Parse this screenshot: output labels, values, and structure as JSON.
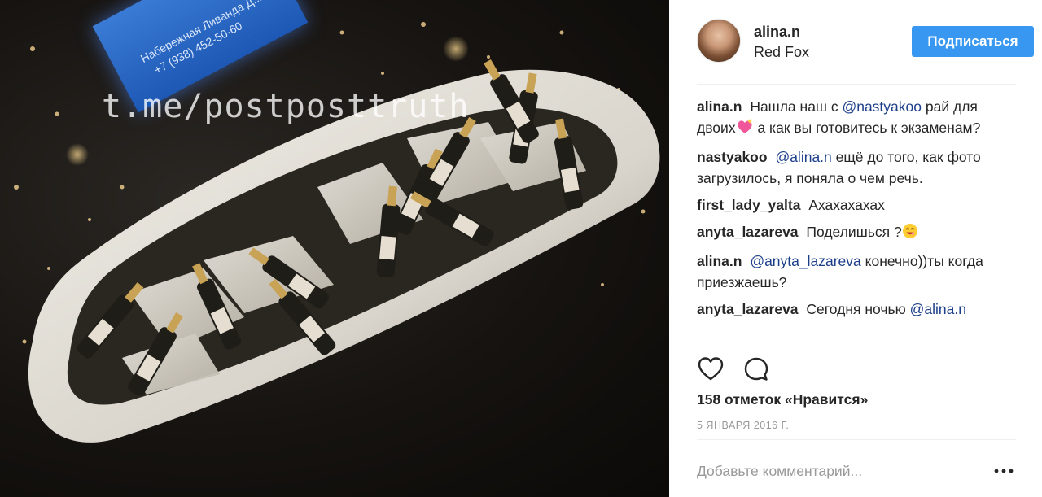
{
  "photo": {
    "watermark": "t.me/postposttruth",
    "sign_line1": "Набережная Ливанда Д...",
    "sign_line2": "+7 (938) 452-50-60"
  },
  "header": {
    "username": "alina.n",
    "location": "Red Fox",
    "follow_label": "Подписаться"
  },
  "comments": [
    {
      "author": "alina.n",
      "text_before": "Нашла наш с",
      "mention": "@nastyakoo",
      "text_after": "рай для двоих",
      "emoji": "sparkling-heart",
      "text_end": "а как вы готовитесь к экзаменам?"
    },
    {
      "author": "nastyakoo",
      "mention": "@alina.n",
      "text_after": "ещё до того, как фото загрузилось, я поняла о чем речь."
    },
    {
      "author": "first_lady_yalta",
      "text": "Ахахахахах"
    },
    {
      "author": "anyta_lazareva",
      "text": "Поделишься ?",
      "emoji": "smiling-face"
    },
    {
      "author": "alina.n",
      "mention": "@anyta_lazareva",
      "text_after": "конечно))ты когда приезжаешь?"
    },
    {
      "author": "anyta_lazareva",
      "text": "Сегодня ночью",
      "mention": "@alina.n"
    }
  ],
  "actions": {
    "likes": "158 отметок «Нравится»",
    "date": "5 ЯНВАРЯ 2016 Г."
  },
  "add_comment": {
    "placeholder": "Добавьте комментарий..."
  },
  "colors": {
    "follow_button": "#3897f0",
    "mention": "#1d3f8a",
    "muted": "#999999"
  }
}
